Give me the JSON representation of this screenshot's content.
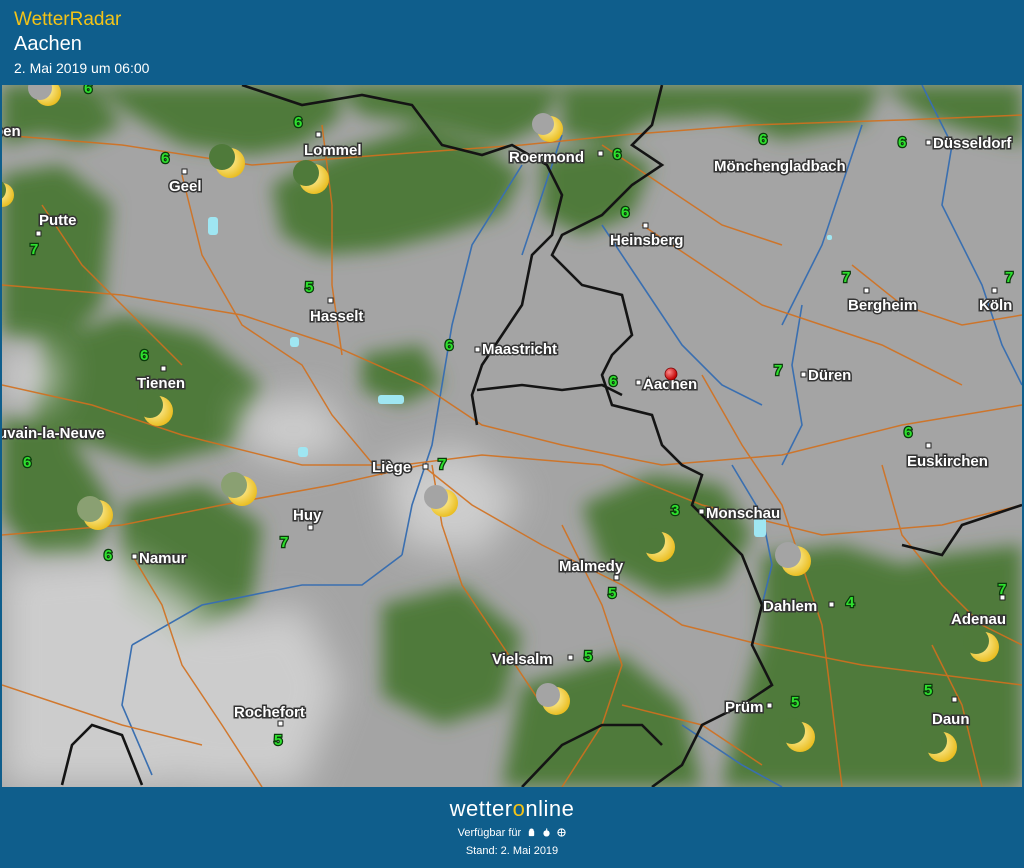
{
  "header": {
    "app_title": "WetterRadar",
    "location": "Aachen",
    "datetime": "2. Mai 2019 um 06:00"
  },
  "footer": {
    "brand_prefix": "wetter",
    "brand_o": "o",
    "brand_suffix": "nline",
    "available_text": "Verfügbar für",
    "platform_icons": [
      "android-icon",
      "apple-icon",
      "web-icon"
    ],
    "stand": "Stand: 2. Mai 2019"
  },
  "colors": {
    "bar": "#0f5e8c",
    "accent": "#f3c318",
    "cloud": "#a8a8a8",
    "land": "#4f7a3a",
    "roads": "#d2701e",
    "rivers": "#3a6fb0",
    "borders": "#141414",
    "temperature": "#2ee02e",
    "marker": "#e01010"
  },
  "map": {
    "cities": [
      {
        "name": "Lommel"
      },
      {
        "name": "Geel"
      },
      {
        "name": "Putte"
      },
      {
        "name": "Roermond"
      },
      {
        "name": "Mönchengladbach"
      },
      {
        "name": "Düsseldorf"
      },
      {
        "name": "Heinsberg"
      },
      {
        "name": "Hasselt"
      },
      {
        "name": "Maastricht"
      },
      {
        "name": "Bergheim"
      },
      {
        "name": "Köln"
      },
      {
        "name": "Tienen"
      },
      {
        "name": "Aachen"
      },
      {
        "name": "Düren"
      },
      {
        "name": "uvain-la-Neuve"
      },
      {
        "name": "Euskirchen"
      },
      {
        "name": "Liège"
      },
      {
        "name": "Huy"
      },
      {
        "name": "Monschau"
      },
      {
        "name": "Namur"
      },
      {
        "name": "Malmedy"
      },
      {
        "name": "Dahlem"
      },
      {
        "name": "Adenau"
      },
      {
        "name": "Vielsalm"
      },
      {
        "name": "Rochefort"
      },
      {
        "name": "Prüm"
      },
      {
        "name": "Daun"
      },
      {
        "name": "pen"
      }
    ],
    "temperatures": [
      {
        "value": "6"
      },
      {
        "value": "6"
      },
      {
        "value": "6"
      },
      {
        "value": "6"
      },
      {
        "value": "6"
      },
      {
        "value": "6"
      },
      {
        "value": "7"
      },
      {
        "value": "5"
      },
      {
        "value": "6"
      },
      {
        "value": "7"
      },
      {
        "value": "7"
      },
      {
        "value": "6"
      },
      {
        "value": "6"
      },
      {
        "value": "7"
      },
      {
        "value": "6"
      },
      {
        "value": "6"
      },
      {
        "value": "7"
      },
      {
        "value": "6"
      },
      {
        "value": "7"
      },
      {
        "value": "3"
      },
      {
        "value": "6"
      },
      {
        "value": "5"
      },
      {
        "value": "7"
      },
      {
        "value": "4"
      },
      {
        "value": "5"
      },
      {
        "value": "5"
      },
      {
        "value": "5"
      },
      {
        "value": "5"
      }
    ],
    "moon_icon": "crescent-moon-icon",
    "marker_icon": "location-pin-icon"
  }
}
